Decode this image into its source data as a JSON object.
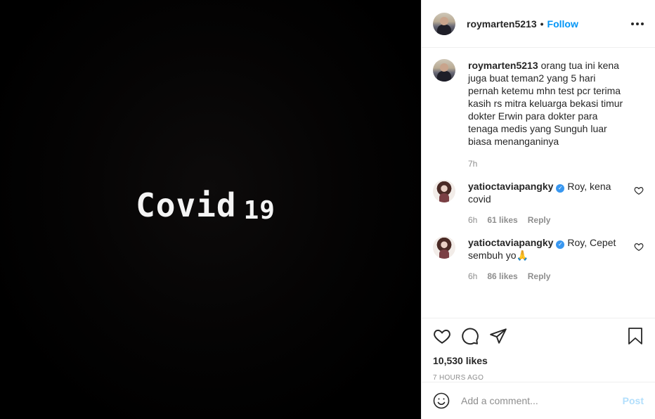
{
  "media": {
    "title_big": "Covid",
    "title_small": "19"
  },
  "header": {
    "username": "roymarten5213",
    "separator": "•",
    "follow_label": "Follow"
  },
  "caption": {
    "username": "roymarten5213",
    "text": "orang tua ini kena juga buat teman2 yang 5 hari pernah ketemu mhn test pcr terima kasih rs mitra keluarga bekasi timur dokter Erwin para dokter para tenaga medis yang Sunguh luar biasa menanganinya",
    "time": "7h"
  },
  "comments": [
    {
      "username": "yatioctaviapangky",
      "verified": true,
      "text": "Roy, kena covid",
      "time": "6h",
      "likes": "61 likes",
      "reply_label": "Reply"
    },
    {
      "username": "yatioctaviapangky",
      "verified": true,
      "text": "Roy, Cepet sembuh yo🙏",
      "time": "6h",
      "likes": "86 likes",
      "reply_label": "Reply"
    }
  ],
  "stats": {
    "likes": "10,530 likes",
    "time_ago": "7 HOURS AGO"
  },
  "add_comment": {
    "placeholder": "Add a comment...",
    "post_label": "Post"
  },
  "icons": {
    "like": "heart-icon",
    "comment": "comment-icon",
    "share": "share-icon",
    "save": "bookmark-icon",
    "emoji": "emoji-icon",
    "more": "more-icon",
    "verified": "verified-badge-icon"
  },
  "colors": {
    "link_blue": "#0095f6",
    "verified_blue": "#3897f0",
    "muted": "#8e8e8e",
    "post_disabled": "#b2dffc",
    "media_bg": "#000000"
  }
}
